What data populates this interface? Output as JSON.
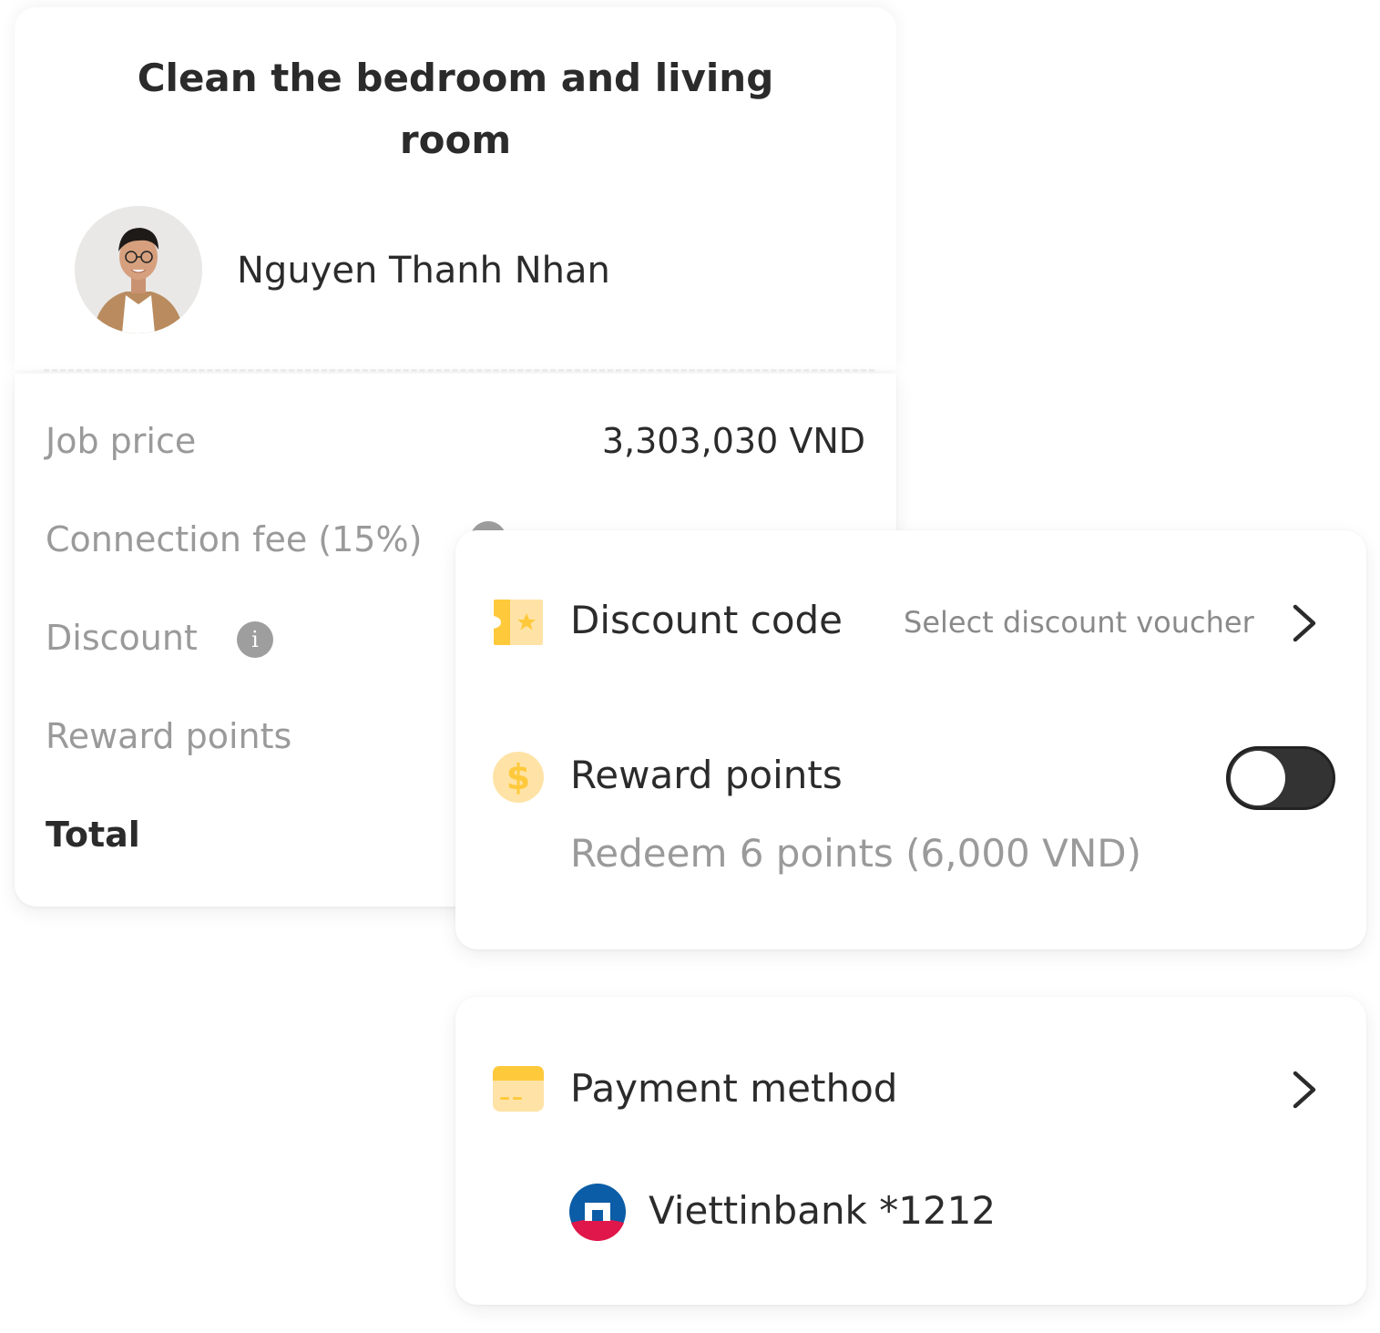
{
  "job": {
    "title": "Clean the bedroom and living room",
    "worker_name": "Nguyen Thanh Nhan"
  },
  "pricing": {
    "job_price_label": "Job price",
    "job_price_value": "3,303,030 VND",
    "connection_fee_label": "Connection fee (15%)",
    "discount_label": "Discount",
    "reward_points_label": "Reward points",
    "total_label": "Total"
  },
  "promo": {
    "discount_code_label": "Discount code",
    "voucher_placeholder": "Select discount voucher",
    "reward_points_label": "Reward points",
    "reward_redeem_text": "Redeem 6 points (6,000 VND)",
    "reward_toggle_on": false
  },
  "payment": {
    "label": "Payment method",
    "bank": "Viettinbank *1212"
  },
  "icons": {
    "voucher": "voucher-ticket-icon",
    "coin": "dollar-coin-icon",
    "card": "credit-card-icon",
    "chevron": "chevron-right-icon",
    "info": "info-icon"
  },
  "colors": {
    "accent_yellow": "#FFC93C",
    "accent_light": "#FFE3A6",
    "toggle_off": "#333333",
    "muted_text": "#9A9A9A",
    "bank_blue": "#0A5DA6",
    "bank_red": "#E0174A"
  }
}
